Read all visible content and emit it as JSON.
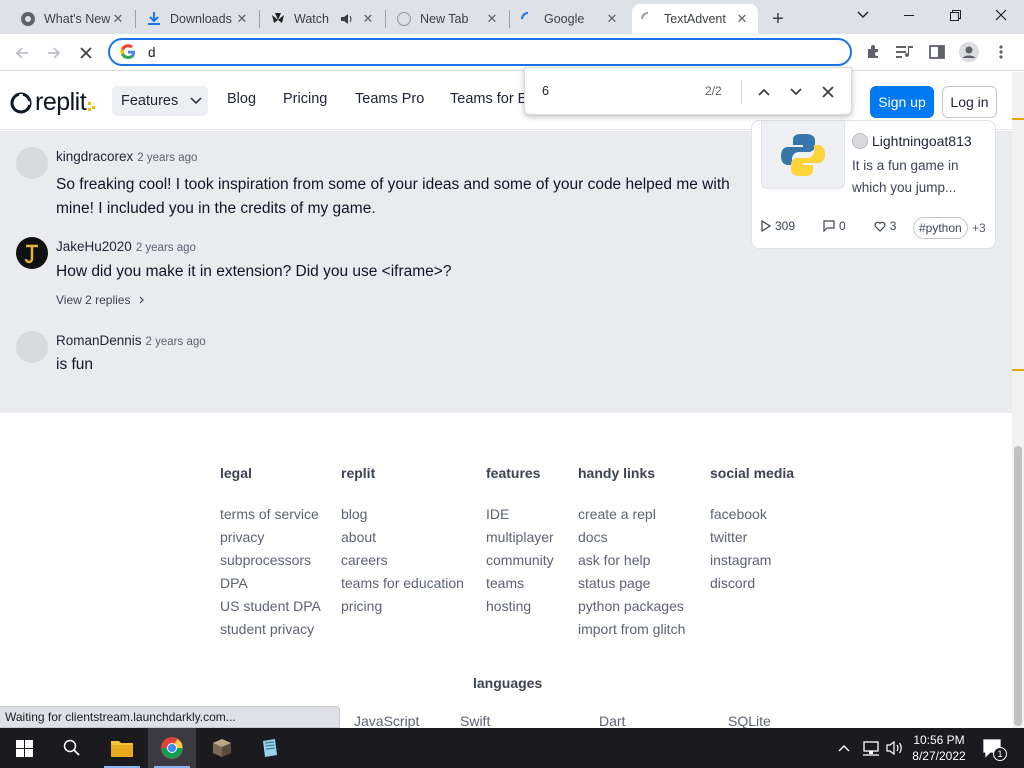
{
  "browser": {
    "tabs": [
      {
        "title": "What's New",
        "icon": "chrome-icon"
      },
      {
        "title": "Downloads",
        "icon": "download-icon"
      },
      {
        "title": "Watch",
        "icon": "nbc-icon"
      },
      {
        "title": "New Tab",
        "icon": "newtab-icon"
      },
      {
        "title": "Google",
        "icon": "loading-icon"
      },
      {
        "title": "TextAdvent",
        "icon": "loading-icon"
      }
    ],
    "new_tab_label": "+",
    "omnibox_value": "d",
    "find": {
      "query": "6",
      "count": "2/2"
    },
    "status_text": "Waiting for clientstream.launchdarkly.com..."
  },
  "site": {
    "logo_text": "replit",
    "nav": {
      "features": "Features",
      "blog": "Blog",
      "pricing": "Pricing",
      "teams_pro": "Teams Pro",
      "teams_for_ed": "Teams for E"
    },
    "signup": "Sign up",
    "login": "Log in"
  },
  "comments": [
    {
      "user": "kingdracorex",
      "time": "2 years ago",
      "body": "So freaking cool! I took inspiration from some of your ideas and some of your code helped me with mine! I included you in the credits of my game."
    },
    {
      "user": "JakeHu2020",
      "time": "2 years ago",
      "body": "How did you make it in extension? Did you use <iframe>?",
      "replies": "View 2 replies"
    },
    {
      "user": "RomanDennis",
      "time": "2 years ago",
      "body": "is fun"
    }
  ],
  "card": {
    "author": "Lightningoat813",
    "desc_line1": "It is a fun game in",
    "desc_line2": "which you jump...",
    "runs": "309",
    "comments": "0",
    "likes": "3",
    "tag": "#python",
    "more_tags": "+3"
  },
  "footer": {
    "columns": [
      {
        "title": "legal",
        "links": [
          "terms of service",
          "privacy",
          "subprocessors",
          "DPA",
          "US student DPA",
          "student privacy"
        ]
      },
      {
        "title": "replit",
        "links": [
          "blog",
          "about",
          "careers",
          "teams for education",
          "pricing"
        ]
      },
      {
        "title": "features",
        "links": [
          "IDE",
          "multiplayer",
          "community",
          "teams",
          "hosting"
        ]
      },
      {
        "title": "handy links",
        "links": [
          "create a repl",
          "docs",
          "ask for help",
          "status page",
          "python packages",
          "import from glitch"
        ]
      },
      {
        "title": "social media",
        "links": [
          "facebook",
          "twitter",
          "instagram",
          "discord"
        ]
      }
    ],
    "languages_title": "languages",
    "languages": [
      "JavaScript",
      "Swift",
      "Dart",
      "SQLite"
    ]
  },
  "taskbar": {
    "time": "10:56 PM",
    "date": "8/27/2022",
    "notification_count": "1"
  }
}
